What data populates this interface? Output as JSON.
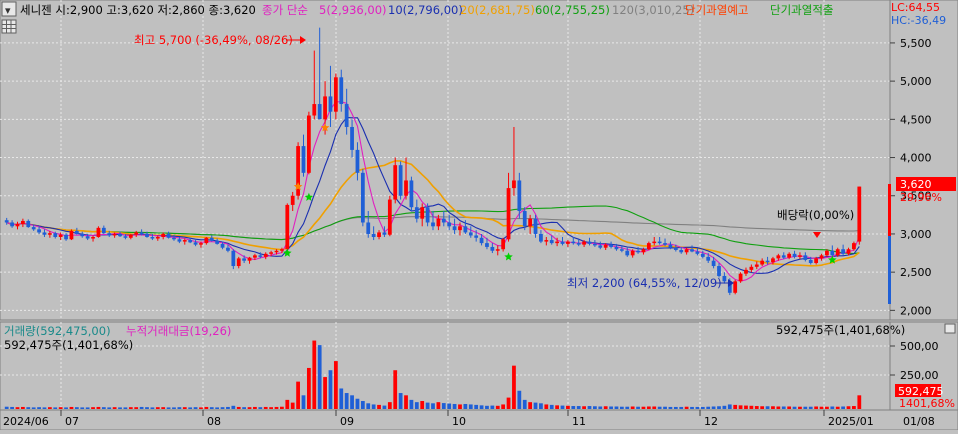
{
  "header": {
    "stock_info": "세니젠 시:2,900 고:3,620 저:2,860 종:3,620",
    "ma_type_label": "종가 단순",
    "ma5_label": "5(2,936,00)",
    "ma10_label": "10(2,796,00)",
    "ma20_label": "20(2,681,75)",
    "ma60_label": "60(2,755,25)",
    "ma120_label": "120(3,010,25)",
    "warn1_label": "단기과열예고",
    "warn2_label": "단기과열적출",
    "lc_label": "LC:64,55",
    "hc_label": "HC:-36,49"
  },
  "colors": {
    "up": "#ff0000",
    "down": "#1f5fd6",
    "ma5": "#e020c0",
    "ma10": "#1a2fb0",
    "ma20": "#f0a000",
    "ma60": "#10a010",
    "ma120": "#808080",
    "background": "#c0c0c0",
    "grid": "#e8e8e8",
    "marker_orange": "#ff8000",
    "marker_green": "#00d000"
  },
  "annotations": {
    "high": "최고 5,700 (-36,49%, 08/26)",
    "low": "최저 2,200 (64,55%, 12/09)",
    "dividend": "배당락(0,00%)",
    "last_price": "3,620",
    "last_pct": "29,96%"
  },
  "volume_panel": {
    "legend1": "거래량(592,475,00)",
    "legend2": "누적거래대금(19,26)",
    "left_value": "592,475주(1,401,68%)",
    "right_value": "592,475주(1,401,68%)",
    "box_value1": "592,475",
    "box_value2": "1401,68%"
  },
  "chart_data": {
    "type": "candlestick",
    "price_axis": {
      "min": 1900,
      "max": 5800,
      "ticks": [
        "2,000",
        "2,500",
        "3,000",
        "3,500",
        "4,000",
        "4,500",
        "5,000",
        "5,500"
      ]
    },
    "volume_axis": {
      "ticks": [
        "250,00",
        "500,00"
      ]
    },
    "x_labels": [
      "2024/06",
      "07",
      "08",
      "09",
      "10",
      "11",
      "12",
      "2025/01",
      "01/08"
    ],
    "candles": [
      [
        3180,
        3210,
        3120,
        3150
      ],
      [
        3150,
        3180,
        3080,
        3100
      ],
      [
        3100,
        3160,
        3060,
        3130
      ],
      [
        3130,
        3200,
        3090,
        3170
      ],
      [
        3170,
        3190,
        3080,
        3090
      ],
      [
        3090,
        3120,
        3040,
        3060
      ],
      [
        3060,
        3100,
        3000,
        3020
      ],
      [
        3020,
        3060,
        2960,
        2990
      ],
      [
        2990,
        3040,
        2950,
        3010
      ],
      [
        3010,
        3030,
        2940,
        2960
      ],
      [
        2960,
        3020,
        2920,
        2990
      ],
      [
        2990,
        3010,
        2910,
        2930
      ],
      [
        2930,
        3060,
        2920,
        3040
      ],
      [
        3040,
        3080,
        2990,
        3000
      ],
      [
        3000,
        3030,
        2950,
        2970
      ],
      [
        2970,
        3000,
        2920,
        2940
      ],
      [
        2940,
        2980,
        2900,
        2960
      ],
      [
        2960,
        3100,
        2950,
        3080
      ],
      [
        3080,
        3110,
        3000,
        3010
      ],
      [
        3010,
        3040,
        2960,
        2980
      ],
      [
        2980,
        3020,
        2950,
        3000
      ],
      [
        3000,
        3030,
        2960,
        2970
      ],
      [
        2970,
        3000,
        2930,
        2950
      ],
      [
        2950,
        3000,
        2930,
        2990
      ],
      [
        2990,
        3040,
        2960,
        3020
      ],
      [
        3020,
        3060,
        2980,
        3000
      ],
      [
        3000,
        3030,
        2950,
        2960
      ],
      [
        2960,
        3000,
        2920,
        2940
      ],
      [
        2940,
        2980,
        2910,
        2960
      ],
      [
        2960,
        3020,
        2930,
        3000
      ],
      [
        3000,
        3030,
        2940,
        2950
      ],
      [
        2950,
        2990,
        2910,
        2930
      ],
      [
        2930,
        2960,
        2880,
        2900
      ],
      [
        2900,
        2940,
        2860,
        2920
      ],
      [
        2920,
        2950,
        2880,
        2890
      ],
      [
        2890,
        2920,
        2840,
        2860
      ],
      [
        2860,
        2900,
        2820,
        2880
      ],
      [
        2880,
        2960,
        2860,
        2950
      ],
      [
        2950,
        2980,
        2900,
        2910
      ],
      [
        2910,
        2940,
        2860,
        2870
      ],
      [
        2870,
        2900,
        2800,
        2820
      ],
      [
        2820,
        2860,
        2760,
        2780
      ],
      [
        2780,
        2800,
        2540,
        2580
      ],
      [
        2580,
        2700,
        2550,
        2680
      ],
      [
        2680,
        2720,
        2620,
        2650
      ],
      [
        2650,
        2700,
        2610,
        2690
      ],
      [
        2690,
        2740,
        2660,
        2720
      ],
      [
        2720,
        2760,
        2680,
        2700
      ],
      [
        2700,
        2760,
        2670,
        2740
      ],
      [
        2740,
        2780,
        2710,
        2760
      ],
      [
        2760,
        2800,
        2730,
        2780
      ],
      [
        2780,
        2820,
        2750,
        2800
      ],
      [
        2800,
        3400,
        2790,
        3380
      ],
      [
        3380,
        3550,
        3300,
        3500
      ],
      [
        3500,
        4200,
        3450,
        4150
      ],
      [
        4150,
        4300,
        3750,
        3800
      ],
      [
        3800,
        4600,
        3780,
        4550
      ],
      [
        4550,
        5400,
        4500,
        4700
      ],
      [
        4700,
        5700,
        4600,
        4500
      ],
      [
        4500,
        5000,
        4300,
        4800
      ],
      [
        4800,
        5200,
        4400,
        4600
      ],
      [
        4600,
        5100,
        4500,
        5050
      ],
      [
        5050,
        5150,
        4600,
        4700
      ],
      [
        4700,
        4900,
        4300,
        4400
      ],
      [
        4400,
        4500,
        4000,
        4100
      ],
      [
        4100,
        4200,
        3700,
        3800
      ],
      [
        3800,
        3850,
        3100,
        3150
      ],
      [
        3150,
        3300,
        2950,
        3000
      ],
      [
        3000,
        3100,
        2920,
        2960
      ],
      [
        2960,
        3050,
        2930,
        3020
      ],
      [
        3020,
        3100,
        2960,
        2990
      ],
      [
        2990,
        3500,
        2970,
        3450
      ],
      [
        3450,
        4000,
        3400,
        3900
      ],
      [
        3900,
        3950,
        3450,
        3500
      ],
      [
        3500,
        4000,
        3450,
        3700
      ],
      [
        3700,
        3750,
        3300,
        3350
      ],
      [
        3350,
        3450,
        3150,
        3200
      ],
      [
        3200,
        3400,
        3100,
        3350
      ],
      [
        3350,
        3400,
        3100,
        3150
      ],
      [
        3150,
        3300,
        3050,
        3100
      ],
      [
        3100,
        3250,
        3050,
        3200
      ],
      [
        3200,
        3300,
        3100,
        3150
      ],
      [
        3150,
        3250,
        3050,
        3100
      ],
      [
        3100,
        3200,
        3000,
        3050
      ],
      [
        3050,
        3150,
        2980,
        3100
      ],
      [
        3100,
        3180,
        3000,
        3020
      ],
      [
        3020,
        3100,
        2950,
        2980
      ],
      [
        2980,
        3050,
        2900,
        2950
      ],
      [
        2950,
        3000,
        2850,
        2880
      ],
      [
        2880,
        2950,
        2800,
        2830
      ],
      [
        2830,
        2880,
        2750,
        2780
      ],
      [
        2780,
        2850,
        2720,
        2800
      ],
      [
        2800,
        2950,
        2770,
        2930
      ],
      [
        2930,
        3800,
        2900,
        3600
      ],
      [
        3600,
        4400,
        3500,
        3700
      ],
      [
        3700,
        3800,
        3200,
        3300
      ],
      [
        3300,
        3350,
        3050,
        3100
      ],
      [
        3100,
        3250,
        3000,
        3200
      ],
      [
        3200,
        3250,
        2950,
        3000
      ],
      [
        3000,
        3050,
        2880,
        2900
      ],
      [
        2900,
        2960,
        2850,
        2920
      ],
      [
        2920,
        2980,
        2860,
        2880
      ],
      [
        2880,
        2950,
        2840,
        2900
      ],
      [
        2900,
        2960,
        2850,
        2870
      ],
      [
        2870,
        2920,
        2830,
        2900
      ],
      [
        2900,
        2960,
        2860,
        2880
      ],
      [
        2880,
        2930,
        2840,
        2860
      ],
      [
        2860,
        2920,
        2830,
        2900
      ],
      [
        2900,
        2950,
        2850,
        2870
      ],
      [
        2870,
        2920,
        2830,
        2850
      ],
      [
        2850,
        2900,
        2800,
        2820
      ],
      [
        2820,
        2880,
        2790,
        2860
      ],
      [
        2860,
        2900,
        2810,
        2830
      ],
      [
        2830,
        2870,
        2780,
        2800
      ],
      [
        2800,
        2850,
        2760,
        2780
      ],
      [
        2780,
        2820,
        2700,
        2720
      ],
      [
        2720,
        2800,
        2690,
        2780
      ],
      [
        2780,
        2830,
        2740,
        2760
      ],
      [
        2760,
        2820,
        2730,
        2800
      ],
      [
        2800,
        2900,
        2790,
        2880
      ],
      [
        2880,
        2960,
        2850,
        2900
      ],
      [
        2900,
        2960,
        2860,
        2880
      ],
      [
        2880,
        2940,
        2840,
        2860
      ],
      [
        2860,
        2900,
        2800,
        2820
      ],
      [
        2820,
        2860,
        2770,
        2790
      ],
      [
        2790,
        2830,
        2740,
        2760
      ],
      [
        2760,
        2820,
        2730,
        2800
      ],
      [
        2800,
        2850,
        2760,
        2770
      ],
      [
        2770,
        2810,
        2720,
        2740
      ],
      [
        2740,
        2780,
        2680,
        2700
      ],
      [
        2700,
        2750,
        2620,
        2650
      ],
      [
        2650,
        2700,
        2550,
        2580
      ],
      [
        2580,
        2620,
        2430,
        2450
      ],
      [
        2450,
        2500,
        2350,
        2380
      ],
      [
        2380,
        2420,
        2200,
        2230
      ],
      [
        2230,
        2400,
        2210,
        2380
      ],
      [
        2380,
        2500,
        2360,
        2480
      ],
      [
        2480,
        2560,
        2450,
        2530
      ],
      [
        2530,
        2600,
        2500,
        2570
      ],
      [
        2570,
        2640,
        2540,
        2600
      ],
      [
        2600,
        2680,
        2580,
        2650
      ],
      [
        2650,
        2700,
        2600,
        2630
      ],
      [
        2630,
        2700,
        2600,
        2680
      ],
      [
        2680,
        2740,
        2650,
        2720
      ],
      [
        2720,
        2760,
        2670,
        2690
      ],
      [
        2690,
        2760,
        2670,
        2740
      ],
      [
        2740,
        2780,
        2680,
        2700
      ],
      [
        2700,
        2760,
        2670,
        2720
      ],
      [
        2720,
        2760,
        2640,
        2660
      ],
      [
        2660,
        2700,
        2600,
        2620
      ],
      [
        2620,
        2700,
        2600,
        2680
      ],
      [
        2680,
        2740,
        2650,
        2720
      ],
      [
        2720,
        2800,
        2700,
        2780
      ],
      [
        2780,
        2850,
        2700,
        2720
      ],
      [
        2720,
        2820,
        2700,
        2800
      ],
      [
        2800,
        2860,
        2720,
        2740
      ],
      [
        2740,
        2820,
        2720,
        2800
      ],
      [
        2800,
        2900,
        2780,
        2880
      ],
      [
        2900,
        3620,
        2860,
        3620
      ]
    ],
    "volume": [
      10,
      9,
      8,
      9,
      8,
      7,
      8,
      7,
      8,
      7,
      8,
      7,
      9,
      8,
      7,
      7,
      8,
      9,
      8,
      7,
      8,
      7,
      7,
      8,
      8,
      9,
      8,
      7,
      8,
      8,
      7,
      7,
      8,
      8,
      7,
      8,
      7,
      9,
      8,
      7,
      8,
      9,
      14,
      9,
      8,
      8,
      9,
      8,
      9,
      8,
      9,
      10,
      40,
      28,
      120,
      60,
      180,
      300,
      280,
      140,
      170,
      210,
      90,
      70,
      60,
      45,
      35,
      25,
      20,
      18,
      15,
      30,
      170,
      70,
      60,
      40,
      30,
      35,
      28,
      25,
      30,
      26,
      24,
      22,
      20,
      22,
      20,
      18,
      16,
      14,
      15,
      14,
      20,
      50,
      190,
      80,
      40,
      30,
      28,
      25,
      20,
      18,
      16,
      15,
      14,
      13,
      13,
      12,
      13,
      12,
      11,
      12,
      11,
      11,
      10,
      10,
      11,
      10,
      10,
      11,
      11,
      10,
      10,
      9,
      9,
      9,
      10,
      9,
      9,
      9,
      10,
      11,
      12,
      14,
      20,
      18,
      16,
      15,
      14,
      13,
      12,
      12,
      12,
      11,
      11,
      11,
      10,
      10,
      10,
      10,
      11,
      10,
      10,
      11,
      10,
      11,
      12,
      13,
      60
    ]
  }
}
